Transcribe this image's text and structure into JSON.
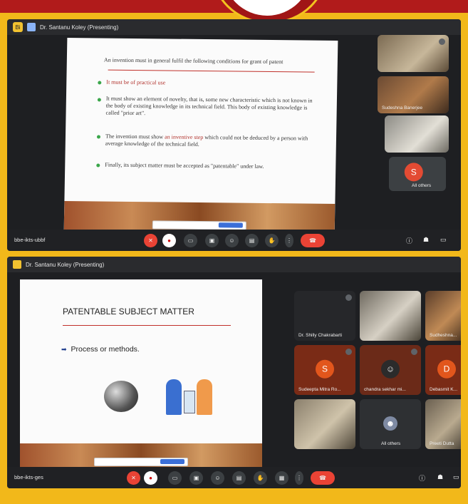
{
  "colors": {
    "frame": "#f2b81a",
    "top": "#b11b1b",
    "meet_bg": "#1e1f22",
    "end_call": "#ea4335",
    "accent": "#8ab4f8"
  },
  "screen1": {
    "app_badge": "Bi",
    "presenter": "Dr. Santanu Koley (Presenting)",
    "slide": {
      "intro": "An invention must in general fulfil the following conditions for grant of patent",
      "b1": "It must be of practical use",
      "b2": "It must show an element of novelty, that is, some new characteristic which is not known in the body of existing knowledge in its technical field. This body of existing knowledge is called \"prior art\".",
      "b3_pre": "The invention must show ",
      "b3_red": "an inventive step",
      "b3_post": " which could not be deduced by a person with average knowledge of the technical field.",
      "b4": "Finally, its subject matter must be accepted as \"patentable\" under law."
    },
    "tiles": [
      {
        "name": "",
        "icon": "person-photo"
      },
      {
        "name": "Sudeshna Banerjee",
        "icon": "person-photo"
      },
      {
        "name": "",
        "icon": "person-photo"
      },
      {
        "name": "All others",
        "avatar": "S"
      }
    ],
    "meeting_code": "bbe-ikts-ubbf"
  },
  "screen2": {
    "presenter": "Dr. Santanu Koley (Presenting)",
    "slide": {
      "title": "PATENTABLE SUBJECT MATTER",
      "item": "Process or methods."
    },
    "tiles": [
      {
        "name": "",
        "type": "blank"
      },
      {
        "name": "Dr. Shilly Chakrabarti",
        "type": "blank"
      },
      {
        "name": "",
        "type": "photo"
      },
      {
        "name": "Sudheshna...",
        "type": "photo"
      },
      {
        "name": "Sudeepta Mitra Ro...",
        "avatar": "S",
        "color": "#c1440e"
      },
      {
        "name": "chandra sekhar mi...",
        "type": "photo"
      },
      {
        "name": "Debasmit K...",
        "avatar": "D",
        "color": "#c1440e"
      },
      {
        "name": "",
        "type": "photo"
      },
      {
        "name": "All others",
        "type": "others"
      },
      {
        "name": "Preeti Dutta",
        "type": "photo"
      }
    ],
    "meeting_code": "bbe-ikts-ges"
  }
}
